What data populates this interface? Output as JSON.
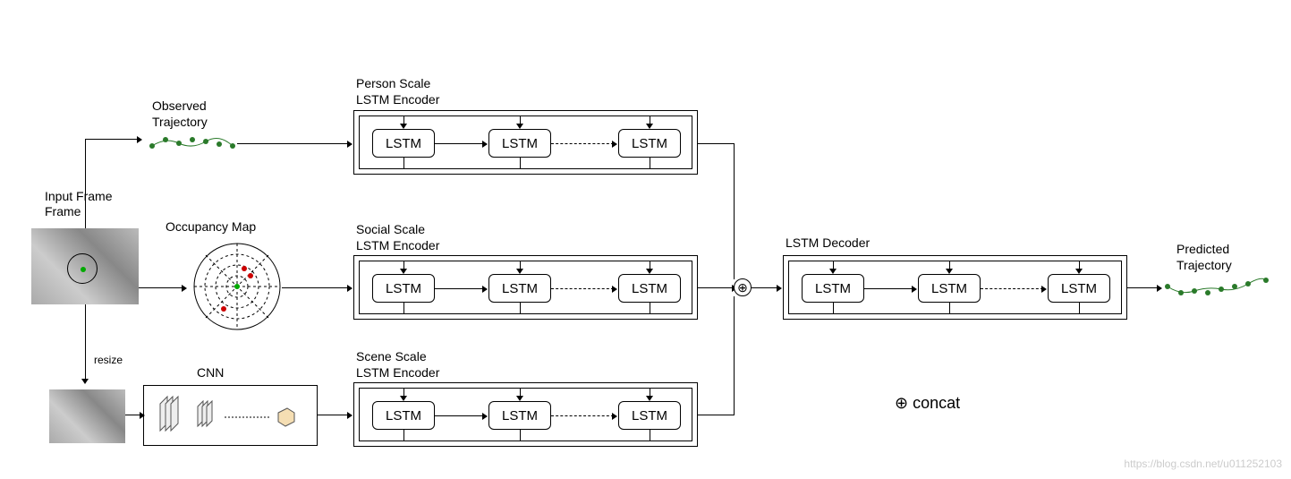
{
  "labels": {
    "input_frame": "Input Frame",
    "observed_traj": "Observed Trajectory",
    "occupancy_map": "Occupancy Map",
    "cnn": "CNN",
    "resize": "resize",
    "person_scale": "Person Scale LSTM Encoder",
    "social_scale": "Social Scale LSTM Encoder",
    "scene_scale": "Scene Scale LSTM Encoder",
    "lstm_decoder": "LSTM Decoder",
    "predicted_traj": "Predicted Trajectory",
    "concat": "concat",
    "concat_symbol": "⊕",
    "lstm": "LSTM"
  },
  "watermark": "https://blog.csdn.net/u011252103",
  "architecture": {
    "encoders": [
      {
        "name": "Person Scale LSTM Encoder",
        "input": "Observed Trajectory",
        "cells": 3
      },
      {
        "name": "Social Scale LSTM Encoder",
        "input": "Occupancy Map",
        "cells": 3
      },
      {
        "name": "Scene Scale LSTM Encoder",
        "input": "CNN features",
        "cells": 3
      }
    ],
    "fusion": "concat",
    "decoder": {
      "name": "LSTM Decoder",
      "cells": 3,
      "output": "Predicted Trajectory"
    }
  }
}
